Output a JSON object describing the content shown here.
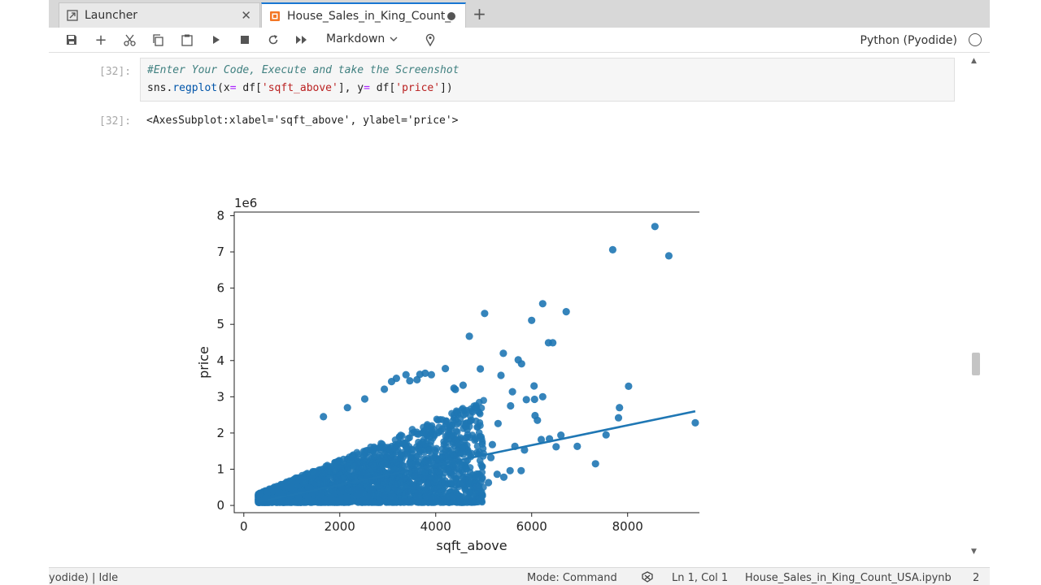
{
  "tabs": [
    {
      "label": "Launcher",
      "icon": "launcher-icon",
      "active": false
    },
    {
      "label": "House_Sales_in_King_Count_",
      "icon": "notebook-icon",
      "active": true
    }
  ],
  "toolbar": {
    "cell_type": "Markdown",
    "kernel_name": "Python (Pyodide)"
  },
  "cell": {
    "input_prompt": "[32]:",
    "code_line1": "#Enter Your Code, Execute and take the Screenshot",
    "code_line2": {
      "p1": "sns",
      "p2": ".",
      "p3": "regplot",
      "p4": "(x",
      "p5": "=",
      "p6": " df[",
      "p7": "'sqft_above'",
      "p8": "], y",
      "p9": "=",
      "p10": " df[",
      "p11": "'price'",
      "p12": "])"
    },
    "output_prompt": "[32]:",
    "output_text": "<AxesSubplot:xlabel='sqft_above', ylabel='price'>"
  },
  "status": {
    "kernel": "yodide) | Idle",
    "mode": "Mode: Command",
    "position": "Ln 1, Col 1",
    "file": "House_Sales_in_King_Count_USA.ipynb",
    "count": "2"
  },
  "colors": {
    "accent": "#1976d2",
    "points": "#1f77b4"
  },
  "chart_data": {
    "type": "scatter",
    "xlabel": "sqft_above",
    "ylabel": "price",
    "offset_label": "1e6",
    "xlim": [
      -200,
      9700
    ],
    "ylim": [
      -0.2,
      8.1
    ],
    "x_ticks": [
      0,
      2000,
      4000,
      6000,
      8000
    ],
    "y_ticks": [
      0,
      1,
      2,
      3,
      4,
      5,
      6,
      7,
      8
    ],
    "y_unit_scale": 1000000,
    "points": [
      [
        8570,
        7.7
      ],
      [
        7690,
        7.06
      ],
      [
        8860,
        6.89
      ],
      [
        6230,
        5.57
      ],
      [
        6720,
        5.35
      ],
      [
        5020,
        5.3
      ],
      [
        6000,
        5.11
      ],
      [
        4700,
        4.67
      ],
      [
        6350,
        4.49
      ],
      [
        6440,
        4.49
      ],
      [
        5410,
        4.2
      ],
      [
        5720,
        4.02
      ],
      [
        5790,
        3.91
      ],
      [
        4200,
        3.78
      ],
      [
        4930,
        3.77
      ],
      [
        3780,
        3.65
      ],
      [
        3670,
        3.62
      ],
      [
        3380,
        3.61
      ],
      [
        3910,
        3.61
      ],
      [
        3180,
        3.51
      ],
      [
        5360,
        3.59
      ],
      [
        3610,
        3.47
      ],
      [
        3080,
        3.42
      ],
      [
        4570,
        3.32
      ],
      [
        4380,
        3.24
      ],
      [
        6050,
        3.3
      ],
      [
        8020,
        3.29
      ],
      [
        5600,
        3.14
      ],
      [
        6230,
        3.0
      ],
      [
        6060,
        2.93
      ],
      [
        7830,
        2.7
      ],
      [
        5890,
        2.92
      ],
      [
        5560,
        2.75
      ],
      [
        7810,
        2.42
      ],
      [
        6120,
        2.35
      ],
      [
        6070,
        2.48
      ],
      [
        9410,
        2.28
      ],
      [
        7550,
        1.95
      ],
      [
        6610,
        1.94
      ],
      [
        6370,
        1.84
      ],
      [
        6200,
        1.82
      ],
      [
        5650,
        1.63
      ],
      [
        5850,
        1.53
      ],
      [
        6510,
        1.62
      ],
      [
        7330,
        1.15
      ],
      [
        6950,
        1.63
      ],
      [
        2160,
        2.7
      ],
      [
        1660,
        2.45
      ],
      [
        2520,
        2.94
      ],
      [
        2930,
        3.21
      ],
      [
        3460,
        3.44
      ],
      [
        4410,
        3.2
      ],
      [
        4850,
        2.7
      ],
      [
        5300,
        2.26
      ],
      [
        5180,
        1.68
      ],
      [
        5150,
        1.32
      ],
      [
        5550,
        0.96
      ],
      [
        5780,
        0.96
      ],
      [
        4970,
        0.76
      ],
      [
        4860,
        0.52
      ],
      [
        5100,
        0.63
      ],
      [
        4520,
        0.6
      ],
      [
        5420,
        0.78
      ],
      [
        5280,
        0.86
      ]
    ],
    "dense_region": {
      "x_range": [
        300,
        5000
      ],
      "y_range": [
        0.08,
        3.1
      ],
      "description_of_counts": "thousands"
    },
    "regression_line": {
      "x": [
        300,
        9410
      ],
      "y": [
        0.1,
        2.6
      ]
    }
  }
}
